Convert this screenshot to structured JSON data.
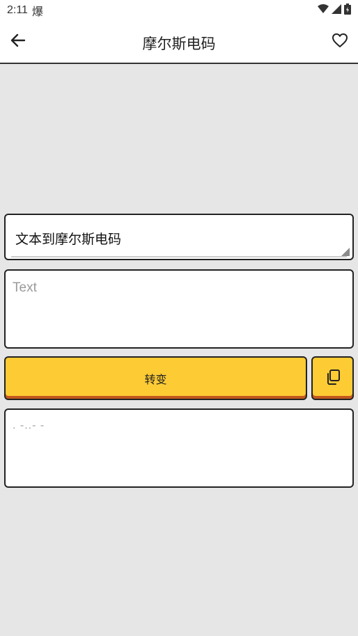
{
  "status_bar": {
    "time": "2:11",
    "notification_glyph": "爆"
  },
  "app_bar": {
    "title": "摩尔斯电码",
    "back_icon": "arrow-left",
    "favorite_icon": "heart-outline"
  },
  "mode_selector": {
    "value": "文本到摩尔斯电码"
  },
  "text_input": {
    "value": "",
    "placeholder": "Text"
  },
  "convert_button": {
    "label": "转变"
  },
  "copy_button": {
    "icon": "copy-icon"
  },
  "output": {
    "text": ". -..- -"
  },
  "colors": {
    "background": "#e6e6e6",
    "button": "#fdcb34",
    "button_shadow": "#c2571d",
    "border": "#222222"
  }
}
